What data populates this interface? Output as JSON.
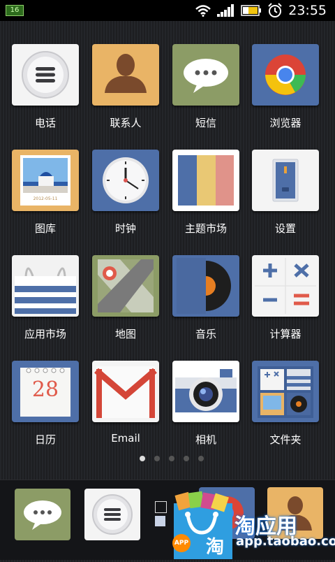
{
  "status_bar": {
    "time": "23:55",
    "notification_icon": "app-notification-icon",
    "icons": [
      "wifi-icon",
      "signal-icon",
      "battery-icon",
      "alarm-icon"
    ]
  },
  "apps": [
    {
      "label": "电话",
      "icon": "phone-icon"
    },
    {
      "label": "联系人",
      "icon": "contacts-icon"
    },
    {
      "label": "短信",
      "icon": "sms-icon"
    },
    {
      "label": "浏览器",
      "icon": "browser-icon"
    },
    {
      "label": "图库",
      "icon": "gallery-icon"
    },
    {
      "label": "时钟",
      "icon": "clock-icon"
    },
    {
      "label": "主题市场",
      "icon": "theme-store-icon"
    },
    {
      "label": "设置",
      "icon": "settings-icon"
    },
    {
      "label": "应用市场",
      "icon": "app-store-icon"
    },
    {
      "label": "地图",
      "icon": "map-icon"
    },
    {
      "label": "音乐",
      "icon": "music-icon"
    },
    {
      "label": "计算器",
      "icon": "calculator-icon"
    },
    {
      "label": "日历",
      "icon": "calendar-icon"
    },
    {
      "label": "Email",
      "icon": "email-icon"
    },
    {
      "label": "相机",
      "icon": "camera-icon"
    },
    {
      "label": "文件夹",
      "icon": "folder-icon"
    }
  ],
  "calendar_day": "28",
  "gallery_date": "2012-05-11",
  "pager": {
    "pages": 5,
    "active": 1
  },
  "dock": [
    "sms-icon",
    "phone-icon",
    "folder-icon",
    "browser-icon",
    "contacts-icon"
  ],
  "watermark": {
    "title": "淘应用",
    "url": "app.taobao.com",
    "badge": "APP",
    "bag_glyph": "淘"
  }
}
